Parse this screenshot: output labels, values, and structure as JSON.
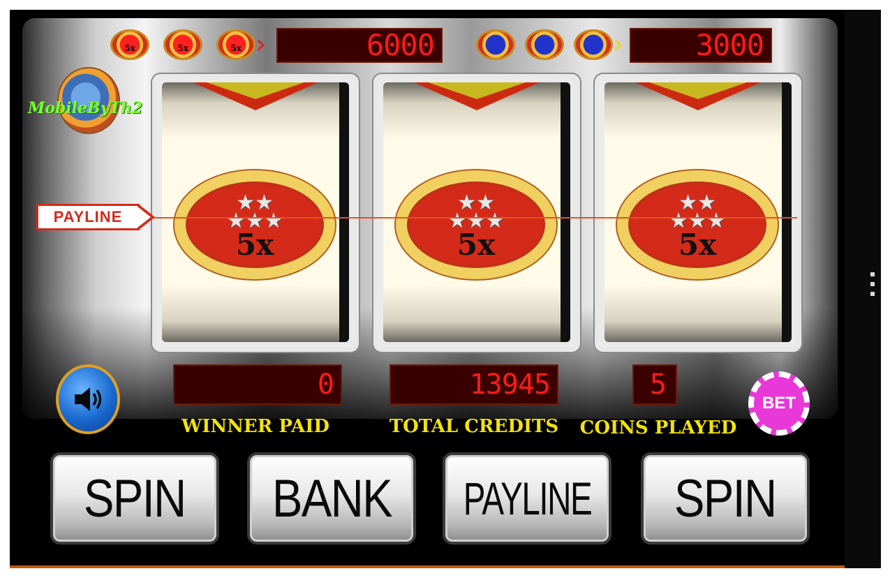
{
  "jackpots": {
    "red": {
      "coin_label": "5x",
      "value": "6000"
    },
    "blue": {
      "value": "3000"
    }
  },
  "logo_text": "MobileByTh2",
  "reels": [
    {
      "symbol": "5x"
    },
    {
      "symbol": "5x"
    },
    {
      "symbol": "5x"
    }
  ],
  "payline_tag": "PAYLINE",
  "displays": {
    "winner_paid": {
      "value": "0",
      "label": "WINNER PAID"
    },
    "total_credits": {
      "value": "13945",
      "label": "TOTAL CREDITS"
    },
    "coins_played": {
      "value": "5",
      "label": "COINS PLAYED"
    }
  },
  "bet_label": "BET",
  "buttons": {
    "spin_left": "SPIN",
    "bank": "BANK",
    "payline": "PAYLINE",
    "spin_right": "SPIN"
  },
  "icons": {
    "sound": "speaker-icon",
    "menu": "overflow-menu-icon"
  },
  "colors": {
    "led_text": "#ff1a1a",
    "label_yellow": "#f2e20a",
    "payline_red": "#d42a1a",
    "bet_chip": "#e838d8"
  }
}
